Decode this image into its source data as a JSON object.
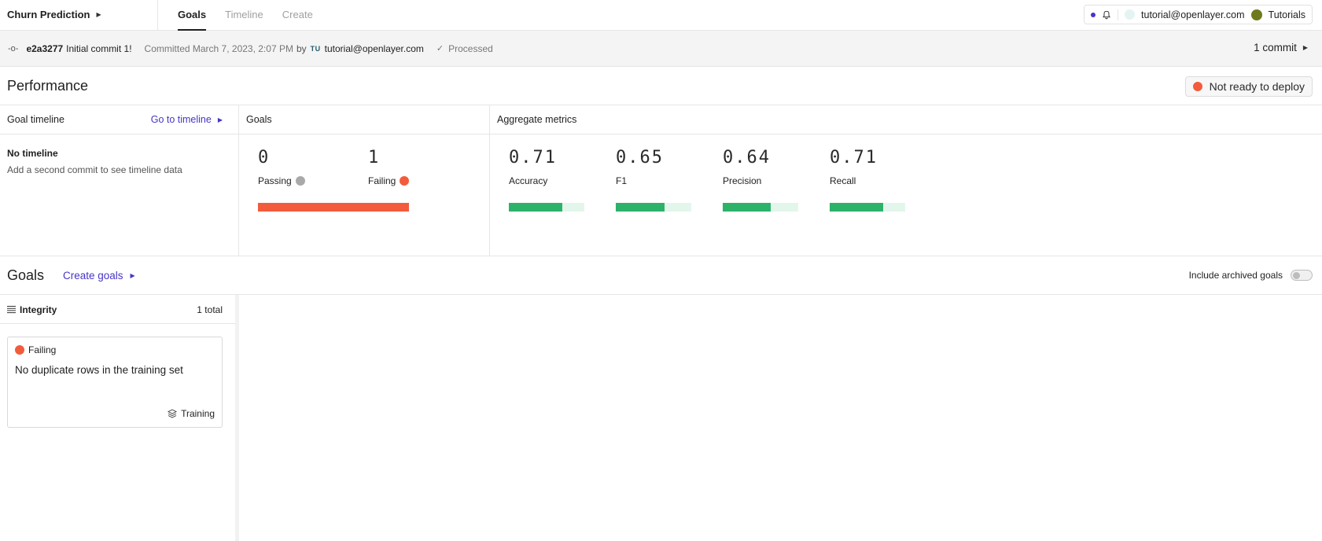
{
  "topbar": {
    "project": "Churn Prediction",
    "tabs": [
      {
        "label": "Goals",
        "active": true
      },
      {
        "label": "Timeline",
        "active": false
      },
      {
        "label": "Create",
        "active": false
      }
    ],
    "user_email": "tutorial@openlayer.com",
    "workspace": "Tutorials"
  },
  "commit": {
    "hash": "e2a3277",
    "message": "Initial commit 1!",
    "committed": "Committed March 7, 2023, 2:07 PM",
    "by": "by",
    "initials": "TU",
    "author": "tutorial@openlayer.com",
    "status": "Processed",
    "count_label": "1 commit"
  },
  "performance": {
    "title": "Performance",
    "deploy_status": "Not ready to deploy",
    "timeline": {
      "header": "Goal timeline",
      "link": "Go to timeline",
      "empty_title": "No timeline",
      "empty_sub": "Add a second commit to see timeline data"
    },
    "goals": {
      "header": "Goals",
      "passing_count": "0",
      "passing_label": "Passing",
      "failing_count": "1",
      "failing_label": "Failing",
      "failing_fraction": 1.0
    },
    "aggregate": {
      "header": "Aggregate metrics",
      "metrics": [
        {
          "value": "0.71",
          "label": "Accuracy",
          "fraction": 0.71
        },
        {
          "value": "0.65",
          "label": "F1",
          "fraction": 0.65
        },
        {
          "value": "0.64",
          "label": "Precision",
          "fraction": 0.64
        },
        {
          "value": "0.71",
          "label": "Recall",
          "fraction": 0.71
        }
      ]
    }
  },
  "goals_section": {
    "title": "Goals",
    "create_link": "Create goals",
    "archived_label": "Include archived goals",
    "archived_on": false,
    "category": {
      "label": "Integrity",
      "total": "1 total"
    },
    "card": {
      "status": "Failing",
      "title": "No duplicate rows in the training set",
      "tag": "Training"
    }
  },
  "colors": {
    "accent": "#4535c9",
    "failing": "#f25c3c",
    "passing_bar": "#2db26a",
    "passing_bar_bg": "#e3f6ec"
  }
}
